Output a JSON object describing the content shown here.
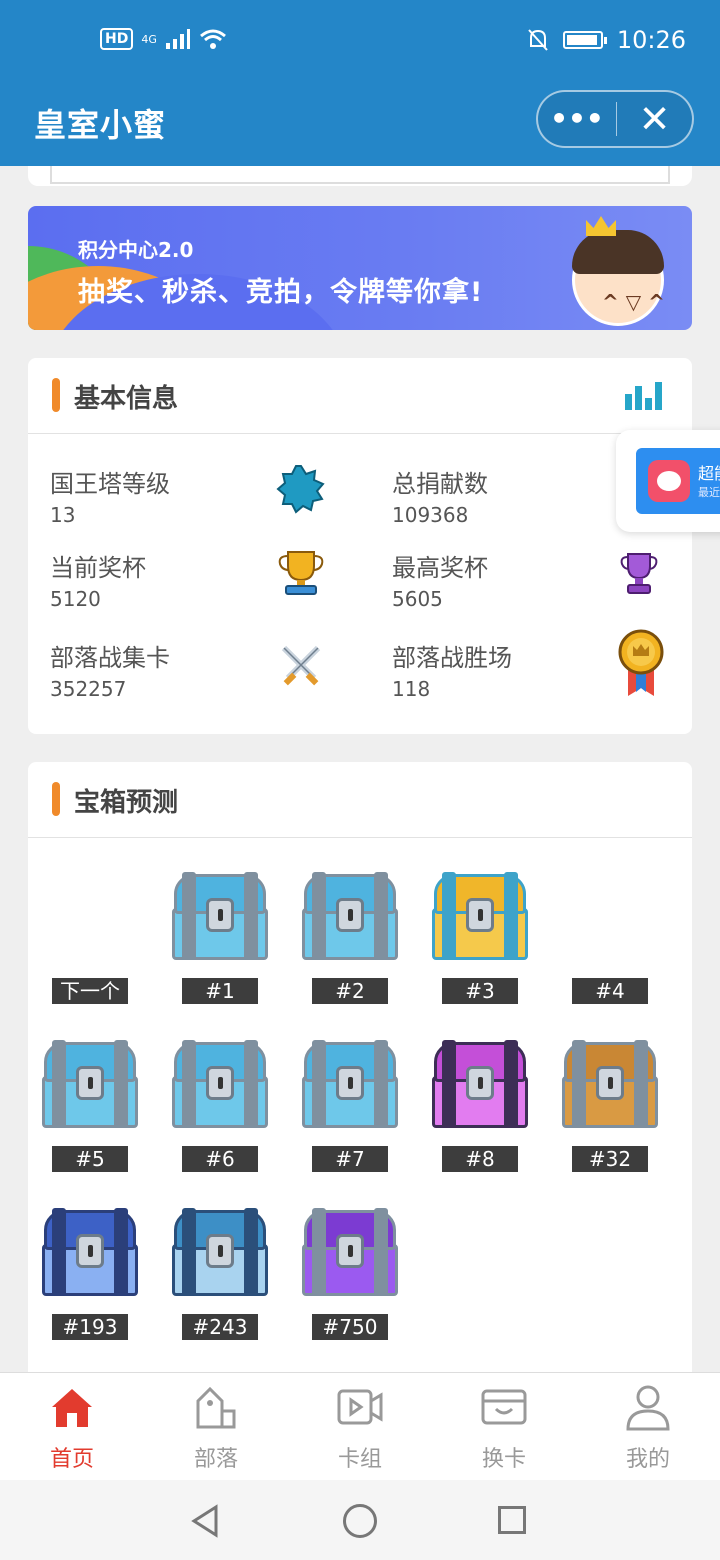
{
  "status": {
    "hd": "HD",
    "network": "4G",
    "time": "10:26",
    "battery_level": 0.95
  },
  "titlebar": {
    "title": "皇室小蜜",
    "more_icon": "more-dots-icon",
    "close_icon": "close-icon"
  },
  "banner": {
    "subtitle": "积分中心2.0",
    "headline": "抽奖、秒杀、竞拍，令牌等你拿!"
  },
  "floating_widget": {
    "title": "超能",
    "subtitle": "最近"
  },
  "basic_info": {
    "title": "基本信息",
    "stats": [
      {
        "label": "国王塔等级",
        "value": "13",
        "icon": "king-level-badge-icon"
      },
      {
        "label": "总捐献数",
        "value": "109368",
        "icon": "donation-icon"
      },
      {
        "label": "当前奖杯",
        "value": "5120",
        "icon": "trophy-gold-icon"
      },
      {
        "label": "最高奖杯",
        "value": "5605",
        "icon": "trophy-purple-icon"
      },
      {
        "label": "部落战集卡",
        "value": "352257",
        "icon": "crossed-swords-icon"
      },
      {
        "label": "部落战胜场",
        "value": "118",
        "icon": "medal-icon"
      }
    ]
  },
  "chest_prediction": {
    "title": "宝箱预测",
    "chests": [
      {
        "label": "下一个",
        "type": "none"
      },
      {
        "label": "#1",
        "type": "silver"
      },
      {
        "label": "#2",
        "type": "silver"
      },
      {
        "label": "#3",
        "type": "gold"
      },
      {
        "label": "#4",
        "type": "none"
      },
      {
        "label": "#5",
        "type": "silver"
      },
      {
        "label": "#6",
        "type": "silver"
      },
      {
        "label": "#7",
        "type": "silver"
      },
      {
        "label": "#8",
        "type": "magic"
      },
      {
        "label": "#32",
        "type": "wooden"
      },
      {
        "label": "#193",
        "type": "lightning"
      },
      {
        "label": "#243",
        "type": "legendary"
      },
      {
        "label": "#750",
        "type": "epic"
      }
    ]
  },
  "tabbar": {
    "tabs": [
      {
        "label": "首页",
        "icon": "home-icon",
        "active": true
      },
      {
        "label": "部落",
        "icon": "clan-icon",
        "active": false
      },
      {
        "label": "卡组",
        "icon": "deck-video-icon",
        "active": false
      },
      {
        "label": "换卡",
        "icon": "card-exchange-icon",
        "active": false
      },
      {
        "label": "我的",
        "icon": "profile-icon",
        "active": false
      }
    ]
  },
  "colors": {
    "primary": "#2486c8",
    "accent": "#f08a2a",
    "active_tab": "#e23b2e"
  }
}
